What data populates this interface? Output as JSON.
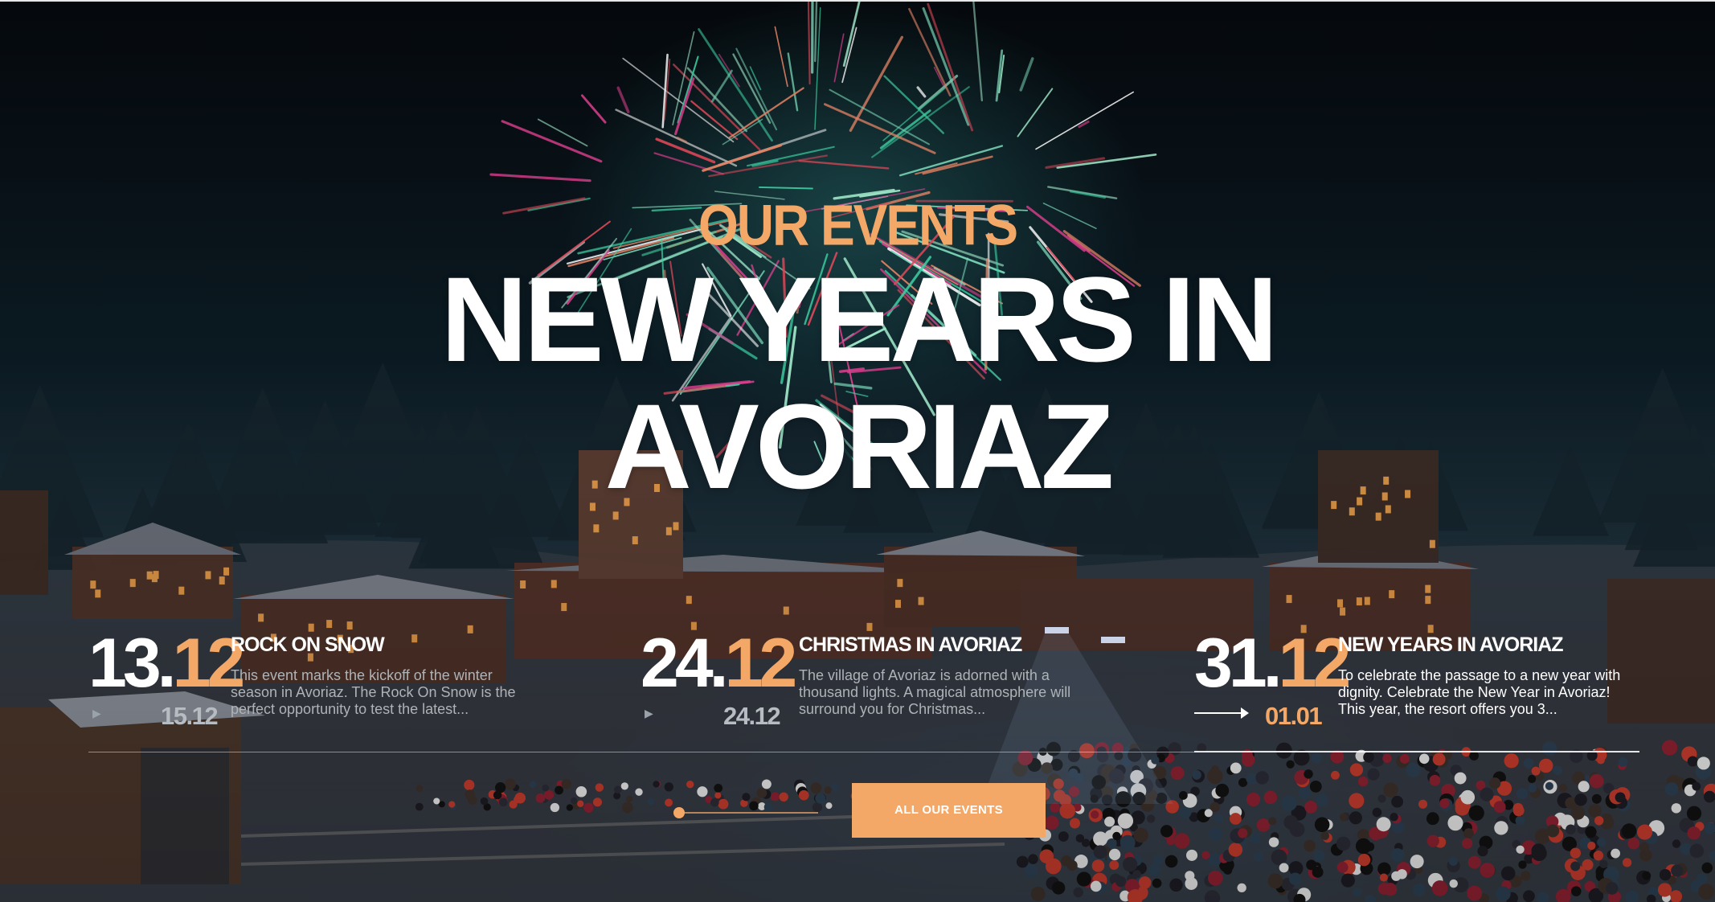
{
  "hero": {
    "kicker": "OUR EVENTS",
    "headline_line1": "NEW YEARS IN",
    "headline_line2": "AVORIAZ"
  },
  "colors": {
    "accent": "#f4a868",
    "text": "#ffffff",
    "muted": "#aeb3b8"
  },
  "events": [
    {
      "day": "13.",
      "month": "12",
      "end_date": "15.12",
      "title": "ROCK ON SNOW",
      "description": "This event marks the kickoff of the winter season in Avoriaz. The Rock On Snow is the perfect opportunity to test the latest...",
      "active": false,
      "icon": "play-icon"
    },
    {
      "day": "24.",
      "month": "12",
      "end_date": "24.12",
      "title": "CHRISTMAS IN AVORIAZ",
      "description": "The village of Avoriaz is adorned with a thousand lights. A magical atmosphere will surround you for Christmas...",
      "active": false,
      "icon": "play-icon"
    },
    {
      "day": "31.",
      "month": "12",
      "end_date": "01.01",
      "title": "NEW YEARS IN AVORIAZ",
      "description": "To celebrate the passage to a new year with dignity. Celebrate the New Year in Avoriaz! This year, the resort offers you 3...",
      "active": true,
      "icon": "arrow-right-icon"
    }
  ],
  "slider": {
    "progress": 0.0
  },
  "cta": {
    "label": "ALL OUR EVENTS"
  }
}
